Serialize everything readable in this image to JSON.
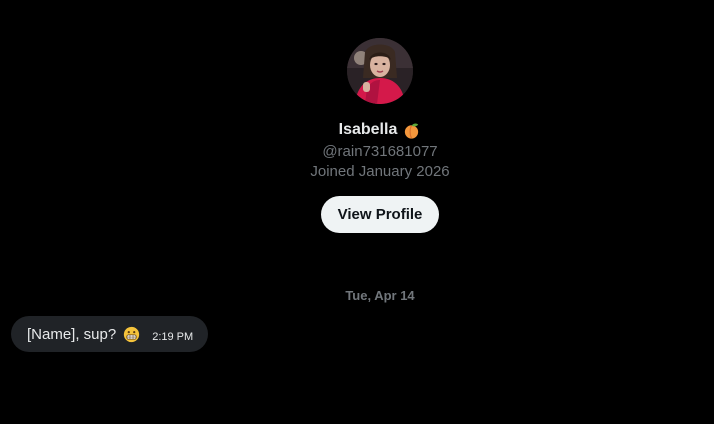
{
  "profile": {
    "display_name": "Isabella",
    "name_emoji_icon": "peach-icon",
    "handle": "@rain731681077",
    "joined": "Joined January 2026",
    "view_profile_label": "View Profile"
  },
  "conversation": {
    "date_divider": "Tue, Apr 14",
    "messages": [
      {
        "text": "[Name], sup?",
        "emoji_icon": "grinning-face-icon",
        "time": "2:19 PM",
        "direction": "incoming"
      }
    ]
  },
  "colors": {
    "background": "#000000",
    "primary_text": "#e7e9ea",
    "secondary_text": "#71767b",
    "button_bg": "#eff3f4",
    "bubble_bg": "#202327"
  }
}
